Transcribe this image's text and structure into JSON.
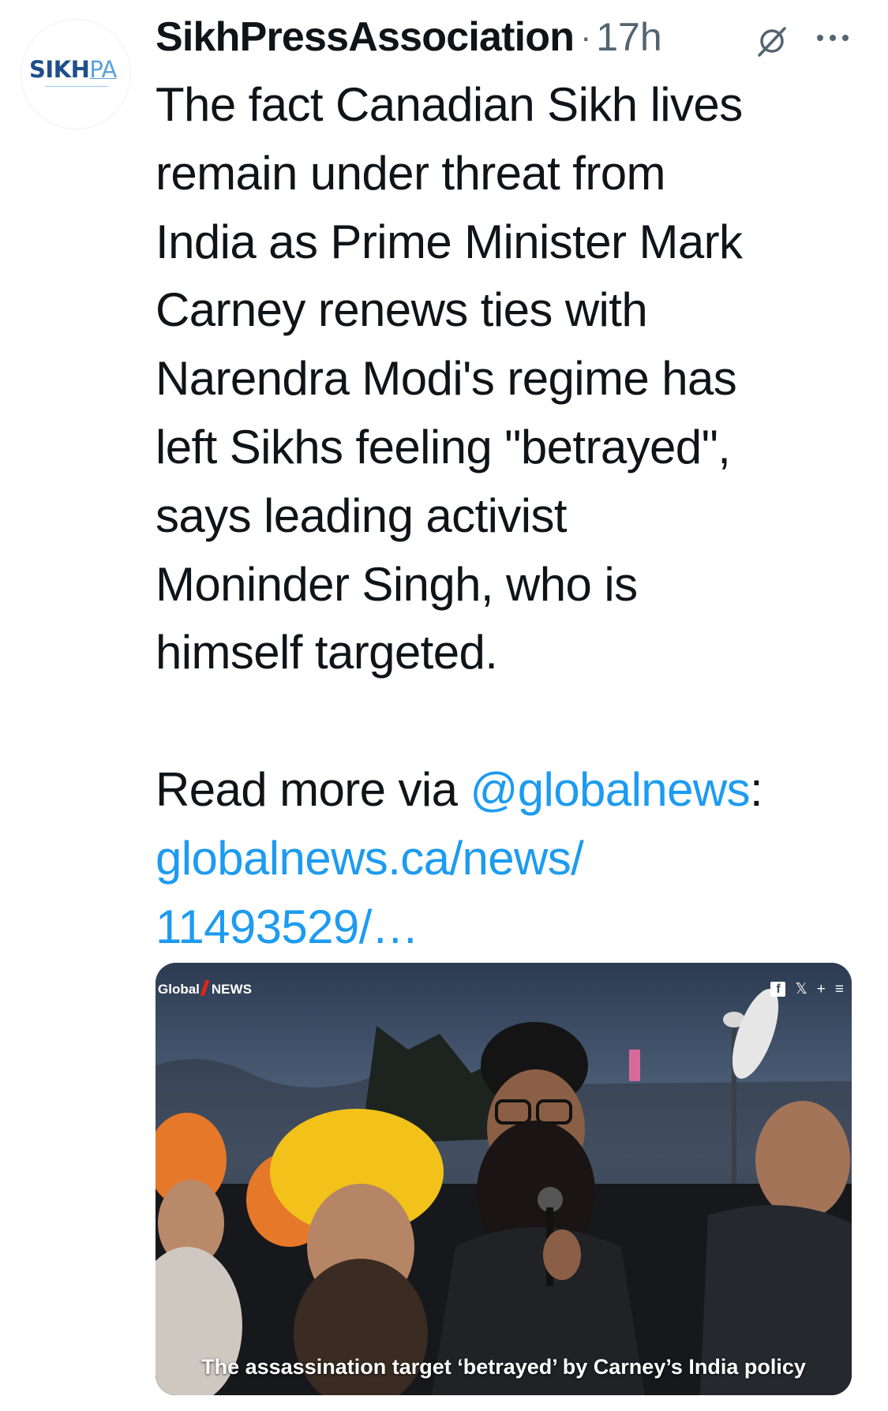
{
  "author": {
    "display_name": "SikhPressAssociation",
    "separator": "·",
    "timestamp": "17h",
    "avatar_logo_sikh": "SIKH",
    "avatar_logo_pa": "PA"
  },
  "tweet": {
    "lines": [
      "The fact Canadian Sikh lives",
      "remain under threat from",
      "India as Prime Minister Mark",
      "Carney renews ties with",
      "Narendra Modi's regime has",
      "left Sikhs feeling \"betrayed\",",
      "says leading activist",
      "Moninder Singh, who is",
      "himself targeted."
    ],
    "read_more_prefix": "Read more via ",
    "mention": "@globalnews",
    "read_more_suffix": ":",
    "url_line1": "globalnews.ca/news/",
    "url_line2": "11493529/…"
  },
  "card": {
    "brand_global": "Global",
    "brand_news": "NEWS",
    "share_icons": [
      "facebook-icon",
      "x-icon",
      "plus-icon",
      "menu-icon"
    ],
    "plus_glyph": "+",
    "x_glyph": "𝕏",
    "menu_glyph": "≡",
    "fb_glyph": "f",
    "caption": "The assassination target ‘betrayed’ by Carney’s India policy"
  },
  "colors": {
    "link": "#1d9bf0",
    "text": "#0f1419",
    "muted": "#536471",
    "turban_yellow": "#f2c21b",
    "turban_orange": "#e6782a"
  }
}
